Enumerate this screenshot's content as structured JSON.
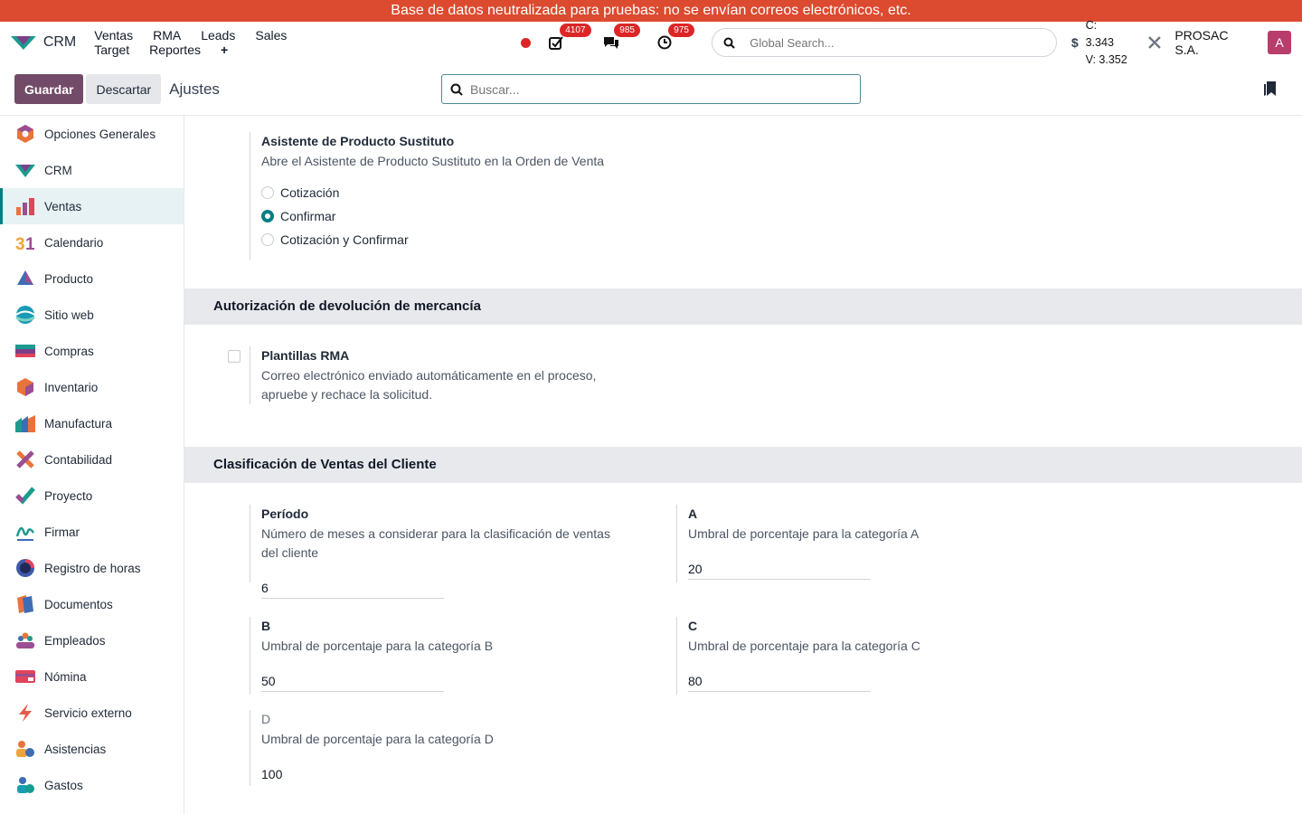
{
  "banner": "Base de datos neutralizada para pruebas: no se envían correos electrónicos, etc.",
  "navbar": {
    "app_name": "CRM",
    "menu": [
      "Ventas",
      "RMA",
      "Leads",
      "Sales Target",
      "Reportes"
    ],
    "plus": "+",
    "activity_badge": "4107",
    "messages_badge": "985",
    "clock_badge": "975",
    "global_search_placeholder": "Global Search...",
    "currency_symbol": "$",
    "rate_buy": "C: 3.343",
    "rate_sell": "V: 3.352",
    "company": "PROSAC S.A.",
    "avatar_letter": "A"
  },
  "controlbar": {
    "save": "Guardar",
    "discard": "Descartar",
    "title": "Ajustes",
    "search_placeholder": "Buscar..."
  },
  "sidebar": {
    "items": [
      {
        "label": "Opciones Generales",
        "icon": "settings-app-icon"
      },
      {
        "label": "CRM",
        "icon": "crm-app-icon"
      },
      {
        "label": "Ventas",
        "icon": "sales-app-icon",
        "active": true
      },
      {
        "label": "Calendario",
        "icon": "calendar-app-icon"
      },
      {
        "label": "Producto",
        "icon": "product-app-icon"
      },
      {
        "label": "Sitio web",
        "icon": "website-app-icon"
      },
      {
        "label": "Compras",
        "icon": "purchase-app-icon"
      },
      {
        "label": "Inventario",
        "icon": "inventory-app-icon"
      },
      {
        "label": "Manufactura",
        "icon": "manufacturing-app-icon"
      },
      {
        "label": "Contabilidad",
        "icon": "accounting-app-icon"
      },
      {
        "label": "Proyecto",
        "icon": "project-app-icon"
      },
      {
        "label": "Firmar",
        "icon": "sign-app-icon"
      },
      {
        "label": "Registro de horas",
        "icon": "timesheet-app-icon"
      },
      {
        "label": "Documentos",
        "icon": "documents-app-icon"
      },
      {
        "label": "Empleados",
        "icon": "employees-app-icon"
      },
      {
        "label": "Nómina",
        "icon": "payroll-app-icon"
      },
      {
        "label": "Servicio externo",
        "icon": "field-service-app-icon"
      },
      {
        "label": "Asistencias",
        "icon": "attendance-app-icon"
      },
      {
        "label": "Gastos",
        "icon": "expenses-app-icon"
      }
    ]
  },
  "substitute": {
    "title": "Asistente de Producto Sustituto",
    "desc": "Abre el Asistente de Producto Sustituto en la Orden de Venta",
    "options": [
      "Cotización",
      "Confirmar",
      "Cotización y Confirmar"
    ],
    "selected": "Confirmar"
  },
  "rma_section": {
    "header": "Autorización de devolución de mercancía",
    "title": "Plantillas RMA",
    "desc_line1": "Correo electrónico enviado automáticamente en el proceso,",
    "desc_line2": "apruebe y rechace la solicitud.",
    "checked": false
  },
  "classification": {
    "header": "Clasificación de Ventas del Cliente",
    "period_title": "Período",
    "period_desc_line1": "Número de meses a considerar para la clasificación de ventas",
    "period_desc_line2": "del cliente",
    "period_value": "6",
    "a_title": "A",
    "a_desc": "Umbral de porcentaje para la categoría A",
    "a_value": "20",
    "b_title": "B",
    "b_desc": "Umbral de porcentaje para la categoría B",
    "b_value": "50",
    "c_title": "C",
    "c_desc": "Umbral de porcentaje para la categoría C",
    "c_value": "80",
    "d_title": "D",
    "d_desc": "Umbral de porcentaje para la categoría D",
    "d_value": "100"
  },
  "colors": {
    "primary": "#714b67",
    "accent": "#017e84",
    "banner": "#dc4a2f",
    "badge": "#dc2626"
  }
}
